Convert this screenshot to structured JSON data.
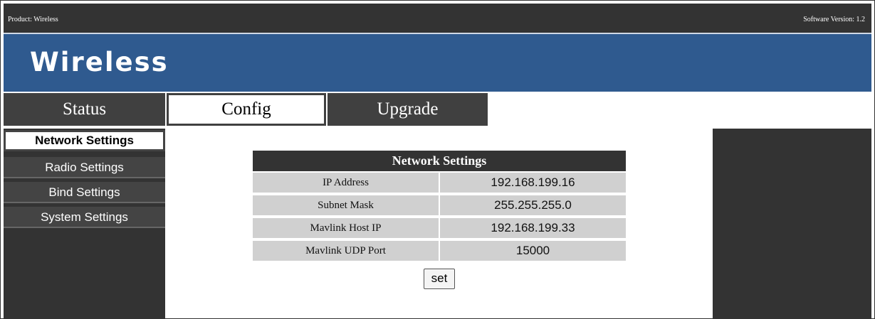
{
  "topbar": {
    "product": "Product: Wireless",
    "version": "Software Version: 1.2"
  },
  "banner": {
    "brand": "Wireless",
    "color": "#2f5a8f"
  },
  "nav": {
    "tabs": [
      {
        "label": "Status",
        "active": false
      },
      {
        "label": "Config",
        "active": true
      },
      {
        "label": "Upgrade",
        "active": false
      }
    ]
  },
  "sidebar": {
    "items": [
      {
        "label": "Network Settings",
        "active": true
      },
      {
        "label": "Radio Settings",
        "active": false
      },
      {
        "label": "Bind Settings",
        "active": false
      },
      {
        "label": "System Settings",
        "active": false
      }
    ]
  },
  "network": {
    "title": "Network Settings",
    "rows": [
      {
        "label": "IP Address",
        "value": "192.168.199.16"
      },
      {
        "label": "Subnet Mask",
        "value": "255.255.255.0"
      },
      {
        "label": "Mavlink Host IP",
        "value": "192.168.199.33"
      },
      {
        "label": "Mavlink UDP Port",
        "value": "15000"
      }
    ],
    "set_label": "set"
  }
}
